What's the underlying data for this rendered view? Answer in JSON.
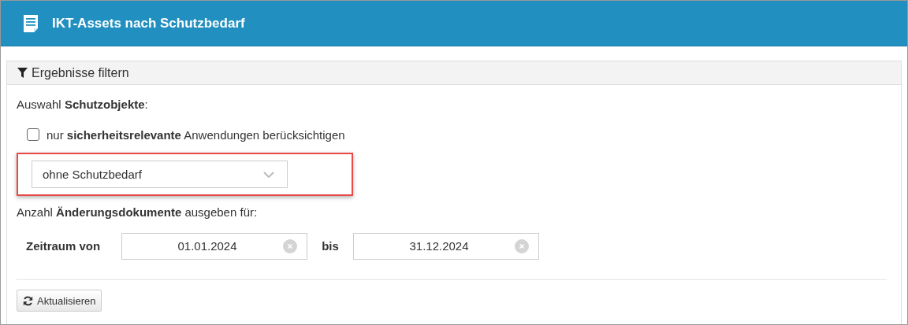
{
  "header": {
    "title": "IKT-Assets nach Schutzbedarf"
  },
  "filter_panel": {
    "title": "Ergebnisse filtern",
    "selection_label": "Auswahl **Schutzobjekte**:",
    "checkbox": {
      "label": "nur **sicherheitsrelevante** Anwendungen berücksichtigen",
      "checked": false
    },
    "dropdown": {
      "value": "ohne Schutzbedarf",
      "highlighted": true
    },
    "count_label": "Anzahl **Änderungsdokumente** ausgeben für:",
    "period": {
      "from_label": "Zeitraum von",
      "from_value": "01.01.2024",
      "to_label": "bis",
      "to_value": "31.12.2024"
    },
    "buttons": [
      {
        "label": "Aktualisieren"
      }
    ]
  }
}
